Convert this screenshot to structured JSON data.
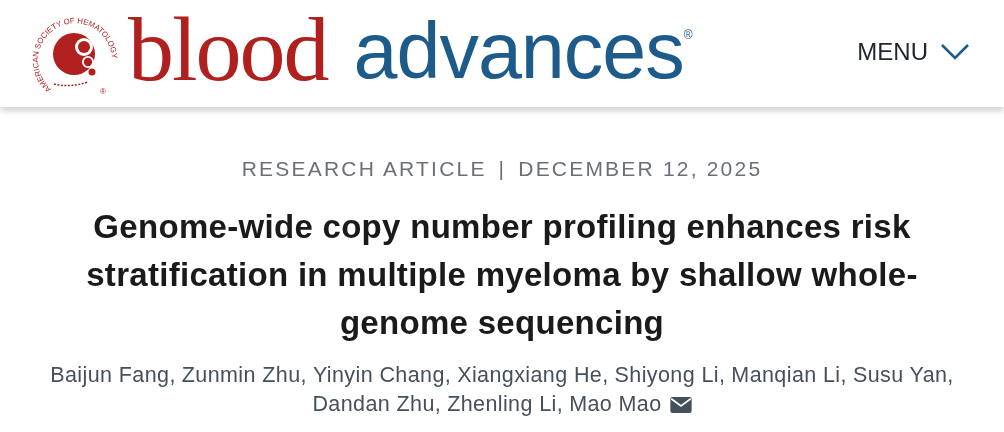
{
  "header": {
    "logo": {
      "society": "AMERICAN SOCIETY OF HEMATOLOGY",
      "society_mark": "®",
      "word_1": "blood",
      "word_2": "advances",
      "word_2_mark": "®"
    },
    "menu": {
      "label": "MENU"
    }
  },
  "article": {
    "type": "RESEARCH ARTICLE",
    "separator": "|",
    "date": "DECEMBER 12, 2025",
    "title": "Genome-wide copy number profiling enhances risk stratification in multiple myeloma by shallow whole-genome sequencing",
    "authors": [
      "Baijun Fang,",
      "Zunmin Zhu,",
      "Yinyin Chang,",
      "Xiangxiang He,",
      "Shiyong Li,",
      "Manqian Li,",
      "Susu Yan,",
      "Dandan Zhu,",
      "Zhenling Li,",
      "Mao Mao"
    ]
  }
}
